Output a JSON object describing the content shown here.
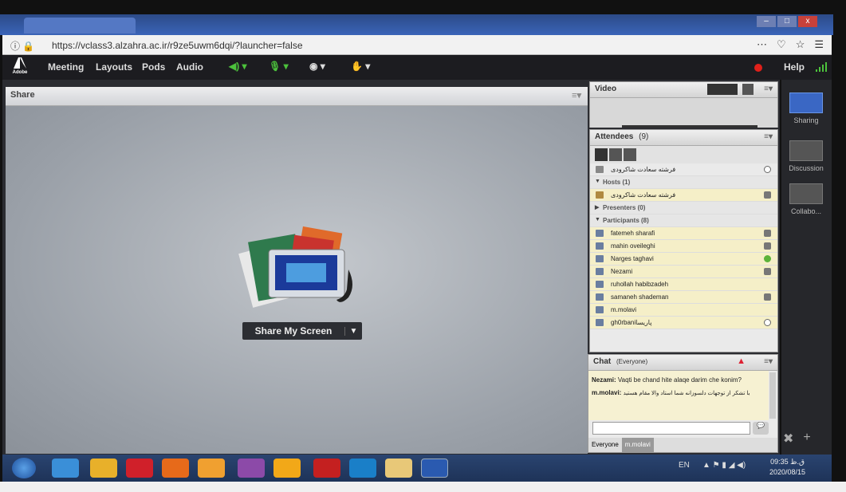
{
  "browser": {
    "url": "https://vclass3.alzahra.ac.ir/r9ze5uwm6dqi/?launcher=false",
    "more_icon": "⋯",
    "tools": [
      "pocket-icon",
      "star-icon",
      "hamburger-icon"
    ]
  },
  "app": {
    "logo": "Adobe",
    "menu": [
      "Meeting",
      "Layouts",
      "Pods",
      "Audio"
    ],
    "help": "Help"
  },
  "share_pod": {
    "title": "Share",
    "button_label": "Share My Screen"
  },
  "video_pod": {
    "title": "Video"
  },
  "attendees": {
    "title": "Attendees",
    "count": "(9)",
    "self_name": "فرشته سعادت شاکرودی",
    "hosts_label": "Hosts (1)",
    "host_name": "فرشته سعادت شاکرودی",
    "presenters_label": "Presenters (0)",
    "participants_label": "Participants (8)",
    "participants": [
      {
        "name": "fatemeh sharafi",
        "status": "mic"
      },
      {
        "name": "mahin oveileghi",
        "status": "mic"
      },
      {
        "name": "Narges taghavi",
        "status": "agree"
      },
      {
        "name": "Nezami",
        "status": "mic"
      },
      {
        "name": "ruhollah habibzadeh",
        "status": ""
      },
      {
        "name": "samaneh shademan",
        "status": "mic"
      },
      {
        "name": "m.molavi",
        "status": ""
      },
      {
        "name": "gh0rbaniپاریسا",
        "status": "away"
      }
    ]
  },
  "chat": {
    "title": "Chat",
    "scope": "(Everyone)",
    "messages": [
      {
        "sender": "Nezami:",
        "text": "Vaqti be chand hite alaqe darim che konim?"
      },
      {
        "sender": "m.molavi:",
        "text": "با تشکر از توجهات دلسوزانه شما استاد والا مقام هستید"
      }
    ],
    "tabs": [
      "Everyone",
      "m.molavi"
    ]
  },
  "layouts_bar": {
    "items": [
      "Sharing",
      "Discussion",
      "Collabo..."
    ]
  },
  "taskbar": {
    "lang": "EN",
    "time": "09:35 ق.ظ",
    "date": "2020/08/15"
  },
  "colors": {
    "accent": "#3a67c4",
    "record": "#e0201a",
    "chat_bg": "#f6f1d2",
    "highlight_row": "#f5efc8"
  }
}
